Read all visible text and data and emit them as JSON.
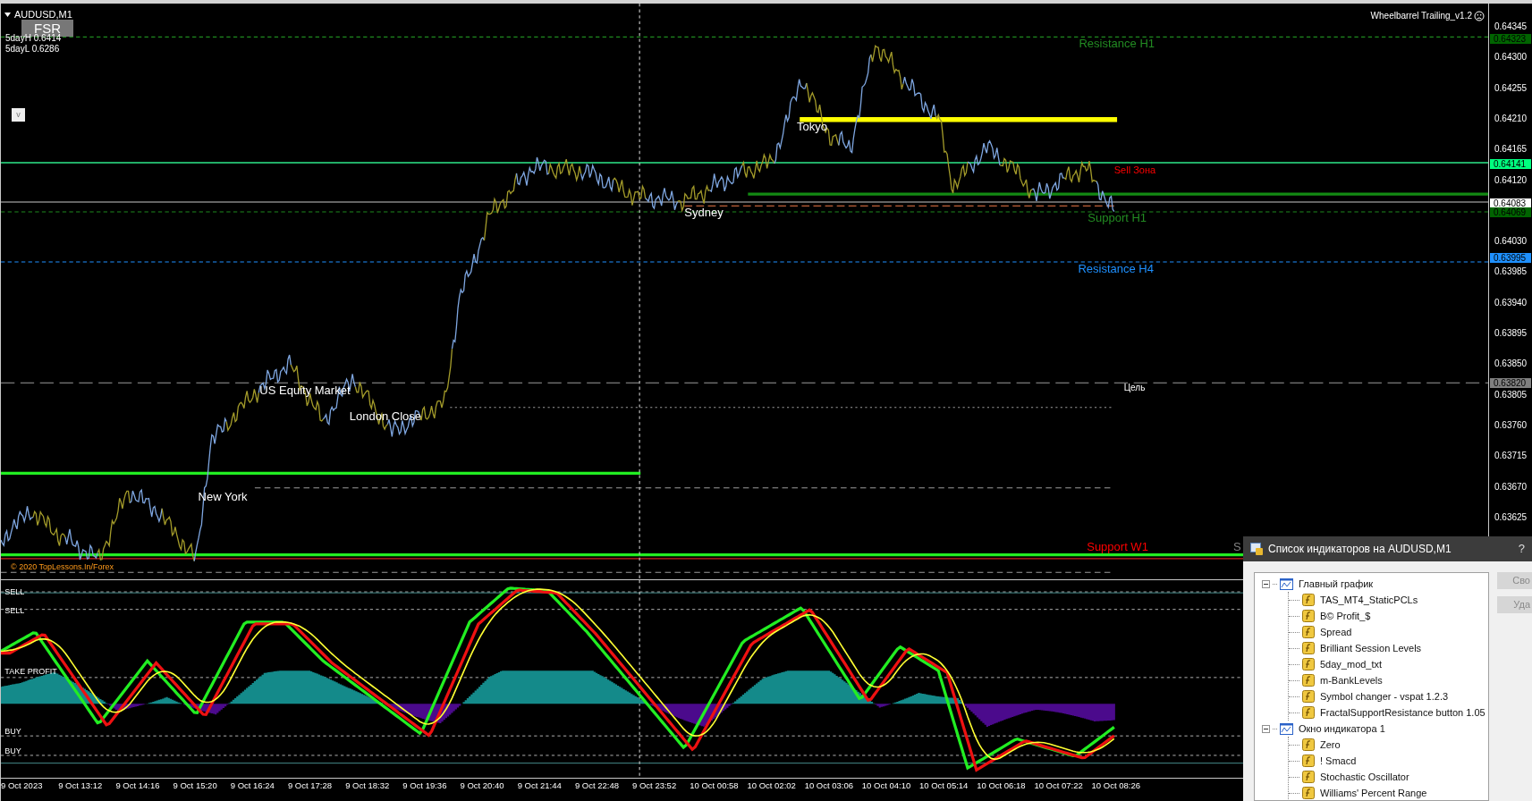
{
  "chart": {
    "symbol": "AUDUSD,M1",
    "fsr_button": "FSR",
    "five_day_high": "5dayH 0.6414",
    "five_day_low": "5dayL 0.6286",
    "toggle_button": "v",
    "expert": "Wheelbarrel Trailing_v1.2",
    "copyright": "© 2020 TopLessons.In/Forex",
    "level_labels": [
      {
        "text": "Resistance H1",
        "color": "#228b22"
      },
      {
        "text": "Tokyo",
        "color": "#ffffff"
      },
      {
        "text": "Sell Зона",
        "color": "#ff0000"
      },
      {
        "text": "Sydney",
        "color": "#ffffff"
      },
      {
        "text": "Support H1",
        "color": "#228b22"
      },
      {
        "text": "Resistance H4",
        "color": "#1e90ff"
      },
      {
        "text": "US Equity Market",
        "color": "#ffffff"
      },
      {
        "text": "Цель",
        "color": "#ffffff"
      },
      {
        "text": "London Close",
        "color": "#ffffff"
      },
      {
        "text": "New York",
        "color": "#ffffff"
      },
      {
        "text": "Support W1",
        "color": "#ff0000"
      },
      {
        "text": "S",
        "color": "#808080"
      }
    ]
  },
  "price_axis": {
    "ticks": [
      "0.64345",
      "0.64300",
      "0.64255",
      "0.64210",
      "0.64165",
      "0.64120",
      "0.64030",
      "0.63985",
      "0.63940",
      "0.63895",
      "0.63850",
      "0.63805",
      "0.63760",
      "0.63715",
      "0.63670",
      "0.63625"
    ],
    "tags": [
      {
        "text": "0.64323",
        "color": "#006400"
      },
      {
        "text": "0.64141",
        "color": "#00ff7f"
      },
      {
        "text": "0.64083",
        "color": "#ffffff"
      },
      {
        "text": "0.64069",
        "color": "#006400"
      },
      {
        "text": "0.63995",
        "color": "#1e90ff"
      },
      {
        "text": "0.63820",
        "color": "#808080"
      }
    ]
  },
  "oscillator": {
    "levels": [
      "SELL",
      "SELL",
      "TAKE PROFIT",
      "BUY",
      "BUY"
    ]
  },
  "time_axis": [
    "9 Oct 2023",
    "9 Oct 13:12",
    "9 Oct 14:16",
    "9 Oct 15:20",
    "9 Oct 16:24",
    "9 Oct 17:28",
    "9 Oct 18:32",
    "9 Oct 19:36",
    "9 Oct 20:40",
    "9 Oct 21:44",
    "9 Oct 22:48",
    "9 Oct 23:52",
    "10 Oct 00:58",
    "10 Oct 02:02",
    "10 Oct 03:06",
    "10 Oct 04:10",
    "10 Oct 05:14",
    "10 Oct 06:18",
    "10 Oct 07:22",
    "10 Oct 08:26"
  ],
  "dialog": {
    "title": "Список индикаторов на AUDUSD,M1",
    "help": "?",
    "buttons": [
      {
        "label": "Сво",
        "disabled": true
      },
      {
        "label": "Уда",
        "disabled": true
      }
    ],
    "tree": [
      {
        "label": "Главный график",
        "expanded": true,
        "children": [
          {
            "label": "TAS_MT4_StaticPCLs"
          },
          {
            "label": "B© Profit_$"
          },
          {
            "label": "Spread"
          },
          {
            "label": "Brilliant Session Levels"
          },
          {
            "label": "5day_mod_txt"
          },
          {
            "label": "m-BankLevels"
          },
          {
            "label": "Symbol changer - vspat 1.2.3"
          },
          {
            "label": "FractalSupportResistance button 1.05"
          }
        ]
      },
      {
        "label": "Окно индикатора 1",
        "expanded": true,
        "children": [
          {
            "label": "Zero"
          },
          {
            "label": "! Smacd"
          },
          {
            "label": "Stochastic Oscillator"
          },
          {
            "label": "Williams' Percent Range"
          }
        ]
      }
    ]
  }
}
